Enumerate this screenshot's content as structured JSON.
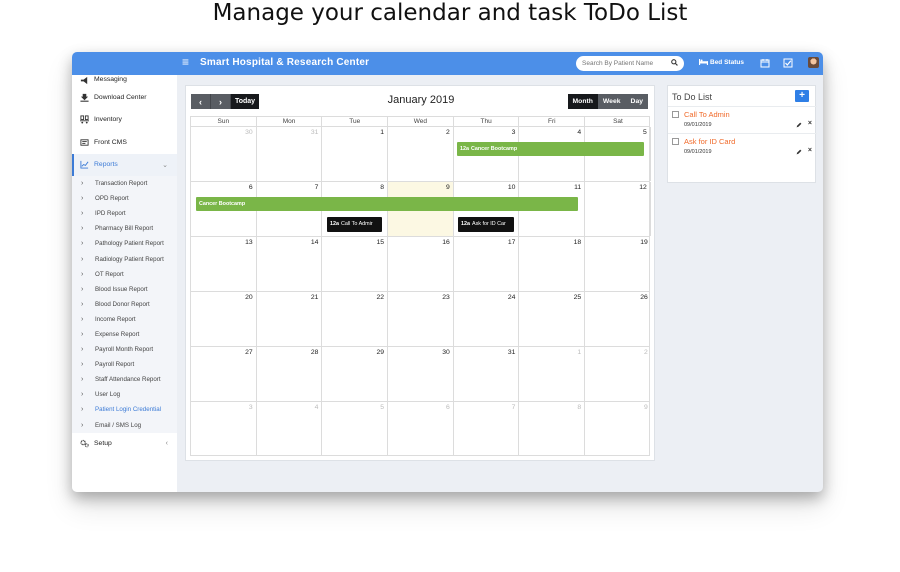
{
  "headline": "Manage your calendar and task ToDo List",
  "topbar": {
    "brand": "Smart Hospital & Research Center",
    "search_placeholder": "Search By Patient Name",
    "bed_status": "Bed Status",
    "accent": "#4c8fe8"
  },
  "sidebar": {
    "items": [
      {
        "label": "Messaging",
        "icon": "megaphone-icon"
      },
      {
        "label": "Download Center",
        "icon": "download-icon"
      },
      {
        "label": "Inventory",
        "icon": "inventory-icon"
      },
      {
        "label": "Front CMS",
        "icon": "cms-icon"
      },
      {
        "label": "Reports",
        "icon": "chart-icon"
      }
    ],
    "reports_sub": [
      "Transaction Report",
      "OPD Report",
      "IPD Report",
      "Pharmacy Bill Report",
      "Pathology Patient Report",
      "Radiology Patient Report",
      "OT Report",
      "Blood Issue Report",
      "Blood Donor Report",
      "Income Report",
      "Expense Report",
      "Payroll Month Report",
      "Payroll Report",
      "Staff Attendance Report",
      "User Log",
      "Patient Login Credential",
      "Email / SMS Log"
    ],
    "setup": "Setup"
  },
  "calendar": {
    "title": "January 2019",
    "today_label": "Today",
    "views": [
      "Month",
      "Week",
      "Day"
    ],
    "active_view": "Month",
    "weekdays": [
      "Sun",
      "Mon",
      "Tue",
      "Wed",
      "Thu",
      "Fri",
      "Sat"
    ],
    "weeks": [
      [
        "30",
        "31",
        "1",
        "2",
        "3",
        "4",
        "5"
      ],
      [
        "6",
        "7",
        "8",
        "9",
        "10",
        "11",
        "12"
      ],
      [
        "13",
        "14",
        "15",
        "16",
        "17",
        "18",
        "19"
      ],
      [
        "20",
        "21",
        "22",
        "23",
        "24",
        "25",
        "26"
      ],
      [
        "27",
        "28",
        "29",
        "30",
        "31",
        "1",
        "2"
      ],
      [
        "3",
        "4",
        "5",
        "6",
        "7",
        "8",
        "9"
      ]
    ],
    "events": {
      "bootcamp_time": "12a",
      "bootcamp_title": "Cancer Bootcamp",
      "bootcamp_title_2": "Cancer Bootcamp",
      "call_time": "12a",
      "call_title": "Call To Admir",
      "idcard_time": "12a",
      "idcard_title": "Ask for ID Car"
    },
    "event_color": "#7ab648"
  },
  "todo": {
    "title": "To Do List",
    "add_label": "+",
    "items": [
      {
        "text": "Call To Admin",
        "date": "09/01/2019"
      },
      {
        "text": "Ask for ID Card",
        "date": "09/01/2019"
      }
    ],
    "item_color": "#f06a2a"
  }
}
